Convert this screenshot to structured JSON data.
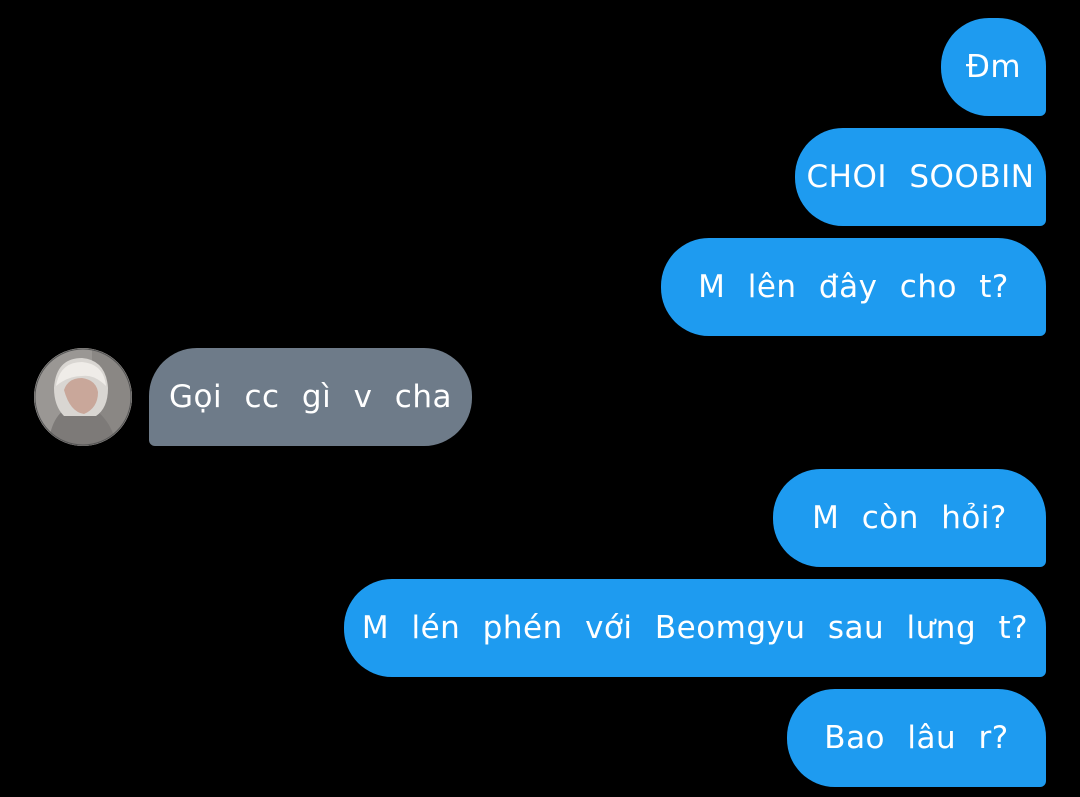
{
  "conversation": {
    "messages": [
      {
        "sender": "me",
        "text": "Đm"
      },
      {
        "sender": "me",
        "text": "CHOI SOOBIN"
      },
      {
        "sender": "me",
        "text": "M lên đây cho t?"
      },
      {
        "sender": "other",
        "text": "Gọi cc gì v cha"
      },
      {
        "sender": "me",
        "text": "M còn hỏi?"
      },
      {
        "sender": "me",
        "text": "M lén phén với Beomgyu sau lưng t?"
      },
      {
        "sender": "me",
        "text": "Bao lâu r?"
      }
    ]
  },
  "colors": {
    "background": "#000000",
    "outgoing_bubble": "#1e9bf0",
    "incoming_bubble": "#6e7b89",
    "text": "#ffffff"
  },
  "icons": {
    "contact_avatar": "user-avatar-photo"
  }
}
